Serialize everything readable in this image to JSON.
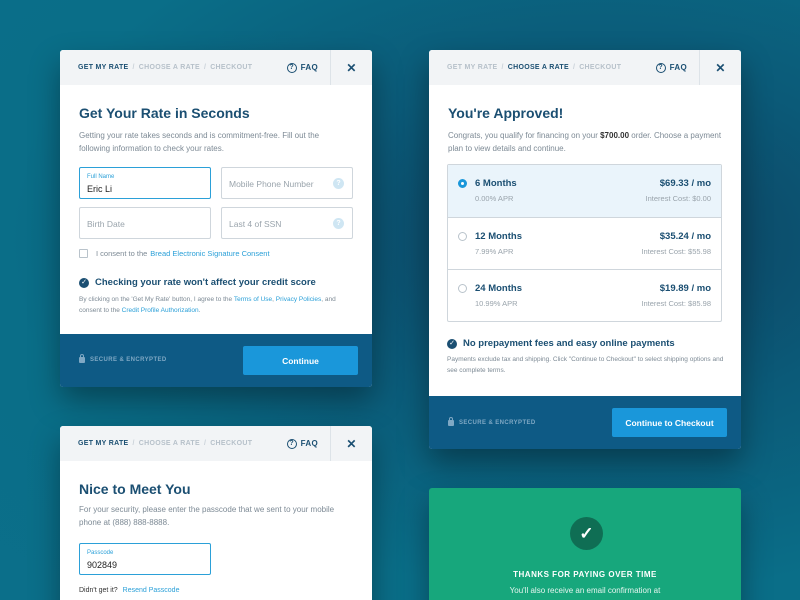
{
  "card1": {
    "steps": [
      "GET MY RATE",
      "CHOOSE A RATE",
      "CHECKOUT"
    ],
    "faq": "FAQ",
    "close": "✕",
    "title": "Get Your Rate in Seconds",
    "subtitle": "Getting your rate takes seconds and is commitment-free. Fill out the following information to check your rates.",
    "full_name_label": "Full Name",
    "full_name_value": "Eric Li",
    "phone_placeholder": "Mobile Phone Number",
    "birth_placeholder": "Birth Date",
    "ssn_placeholder": "Last 4 of SSN",
    "consent_text": "I consent to the",
    "consent_link": "Bread Electronic Signature Consent",
    "note_title": "Checking your rate won't affect your credit score",
    "legal_1": "By clicking on the 'Get My Rate' button, I agree to the",
    "legal_link_1": "Terms of Use",
    "legal_comma": ",",
    "legal_link_2": "Privacy Policies",
    "legal_2": ", and consent to the",
    "legal_link_3": "Credit Profile Authorization",
    "legal_end": ".",
    "secure": "SECURE & ENCRYPTED",
    "button": "Continue"
  },
  "card2": {
    "steps": [
      "GET MY RATE",
      "CHOOSE A RATE",
      "CHECKOUT"
    ],
    "faq": "FAQ",
    "close": "✕",
    "title": "You're Approved!",
    "subtitle_1": "Congrats, you qualify for financing on your",
    "subtitle_amount": "$700.00",
    "subtitle_2": "order. Choose a payment plan to view details and continue.",
    "plans": [
      {
        "name": "6 Months",
        "apr": "0.00% APR",
        "price": "$69.33 / mo",
        "interest": "Interest Cost: $0.00",
        "selected": true
      },
      {
        "name": "12 Months",
        "apr": "7.99% APR",
        "price": "$35.24 / mo",
        "interest": "Interest Cost: $55.98",
        "selected": false
      },
      {
        "name": "24 Months",
        "apr": "10.99% APR",
        "price": "$19.89 / mo",
        "interest": "Interest Cost: $85.98",
        "selected": false
      }
    ],
    "note_title": "No prepayment fees and easy online payments",
    "note_text": "Payments exclude tax and shipping.  Click \"Continue to Checkout\" to select shipping options and see complete terms.",
    "secure": "SECURE & ENCRYPTED",
    "button": "Continue to Checkout"
  },
  "card3": {
    "steps": [
      "GET MY RATE",
      "CHOOSE A RATE",
      "CHECKOUT"
    ],
    "faq": "FAQ",
    "close": "✕",
    "title": "Nice to Meet You",
    "subtitle": "For your security, please enter the passcode that we sent to your mobile phone at (888) 888-8888.",
    "passcode_label": "Passcode",
    "passcode_value": "902849",
    "didnt_get": "Didn't get it?",
    "resend": "Resend Passcode"
  },
  "card4": {
    "check": "✓",
    "heading": "THANKS FOR PAYING OVER TIME",
    "text": "You'll also receive an email confirmation at"
  },
  "colors": {
    "navy": "#1b4f72",
    "accent": "#1a97da",
    "footer": "#0e5a85",
    "green": "#17a77c"
  }
}
